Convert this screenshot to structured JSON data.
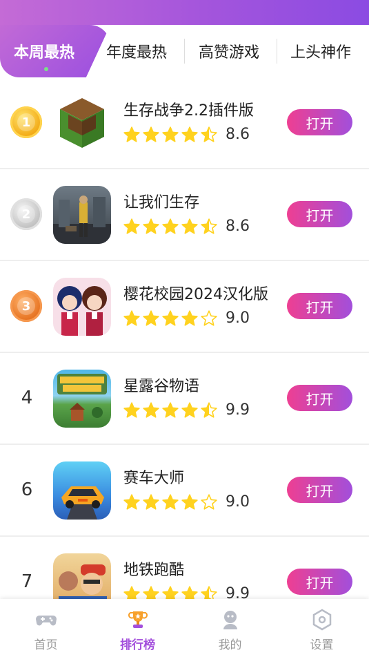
{
  "tabs": [
    {
      "label": "本周最热",
      "active": true
    },
    {
      "label": "年度最热",
      "active": false
    },
    {
      "label": "高赞游戏",
      "active": false
    },
    {
      "label": "上头神作",
      "active": false
    }
  ],
  "games": [
    {
      "rank": "1",
      "medal": "gold",
      "title": "生存战争2.2插件版",
      "stars": 4.5,
      "score": "8.6",
      "button": "打开"
    },
    {
      "rank": "2",
      "medal": "silver",
      "title": "让我们生存",
      "stars": 4.5,
      "score": "8.6",
      "button": "打开"
    },
    {
      "rank": "3",
      "medal": "bronze",
      "title": "樱花校园2024汉化版",
      "stars": 4,
      "score": "9.0",
      "button": "打开"
    },
    {
      "rank": "4",
      "medal": "",
      "title": "星露谷物语",
      "stars": 4.5,
      "score": "9.9",
      "button": "打开"
    },
    {
      "rank": "6",
      "medal": "",
      "title": "赛车大师",
      "stars": 4,
      "score": "9.0",
      "button": "打开"
    },
    {
      "rank": "7",
      "medal": "",
      "title": "地铁跑酷",
      "stars": 4.5,
      "score": "9.9",
      "button": "打开"
    }
  ],
  "bottom_nav": [
    {
      "label": "首页",
      "icon": "gamepad-icon",
      "active": false
    },
    {
      "label": "排行榜",
      "icon": "trophy-icon",
      "active": true
    },
    {
      "label": "我的",
      "icon": "user-icon",
      "active": false
    },
    {
      "label": "设置",
      "icon": "settings-icon",
      "active": false
    }
  ],
  "colors": {
    "accent_gradient_start": "#ee3f92",
    "accent_gradient_end": "#a24fdb",
    "header": "#a455dc",
    "star": "#ffd21f",
    "nav_active": "#a34fdc"
  }
}
